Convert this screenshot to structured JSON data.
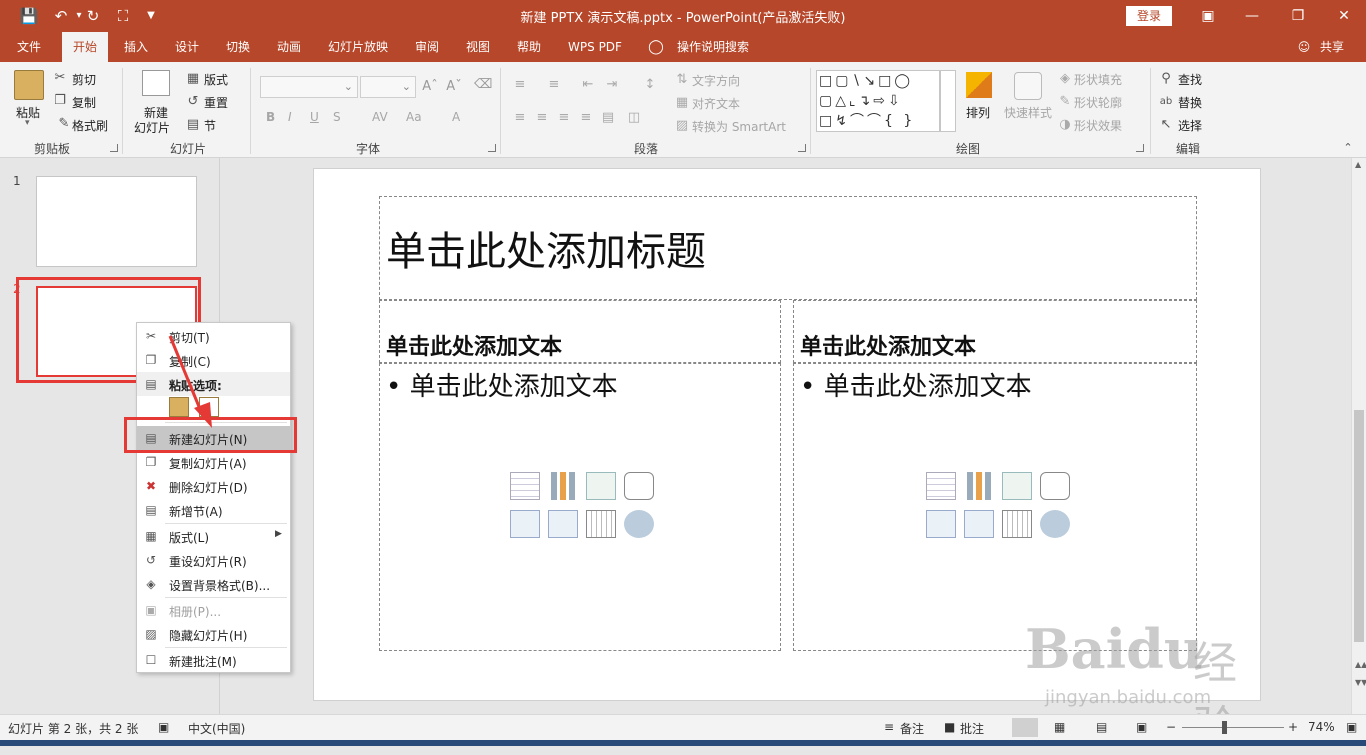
{
  "window": {
    "title": "新建 PPTX 演示文稿.pptx  -  PowerPoint(产品激活失败)",
    "login_label": "登录"
  },
  "tabs": [
    {
      "label": "文件"
    },
    {
      "label": "开始"
    },
    {
      "label": "插入"
    },
    {
      "label": "设计"
    },
    {
      "label": "切换"
    },
    {
      "label": "动画"
    },
    {
      "label": "幻灯片放映"
    },
    {
      "label": "审阅"
    },
    {
      "label": "视图"
    },
    {
      "label": "帮助"
    },
    {
      "label": "WPS PDF"
    },
    {
      "label": "操作说明搜索"
    }
  ],
  "share_label": "共享",
  "ribbon": {
    "clipboard": {
      "paste": "粘贴",
      "cut": "剪切",
      "copy": "复制",
      "format_painter": "格式刷",
      "group": "剪贴板"
    },
    "slides": {
      "new_slide_line1": "新建",
      "new_slide_line2": "幻灯片",
      "layout": "版式",
      "reset": "重置",
      "section": "节",
      "group": "幻灯片"
    },
    "font": {
      "bold": "B",
      "italic": "I",
      "underline": "U",
      "shadow": "S",
      "spacing": "AV",
      "case": "Aa",
      "color": "A",
      "group": "字体"
    },
    "paragraph": {
      "text_direction": "文字方向",
      "align_text": "对齐文本",
      "smartart": "转换为 SmartArt",
      "group": "段落"
    },
    "drawing": {
      "arrange": "排列",
      "quick_styles": "快速样式",
      "shape_fill": "形状填充",
      "shape_outline": "形状轮廓",
      "shape_effects": "形状效果",
      "group": "绘图"
    },
    "editing": {
      "find": "查找",
      "replace": "替换",
      "select": "选择",
      "group": "编辑"
    }
  },
  "thumbnails": [
    {
      "number": "1"
    },
    {
      "number": "2"
    }
  ],
  "slide": {
    "title_placeholder": "单击此处添加标题",
    "left_heading": "单击此处添加文本",
    "left_body": "• 单击此处添加文本",
    "right_heading": "单击此处添加文本",
    "right_body": "• 单击此处添加文本"
  },
  "context_menu": {
    "cut": "剪切(T)",
    "copy": "复制(C)",
    "paste_options": "粘贴选项:",
    "new_slide": "新建幻灯片(N)",
    "duplicate_slide": "复制幻灯片(A)",
    "delete_slide": "删除幻灯片(D)",
    "new_section": "新增节(A)",
    "layout": "版式(L)",
    "reset_slide": "重设幻灯片(R)",
    "format_background": "设置背景格式(B)...",
    "photo_album": "相册(P)...",
    "hide_slide": "隐藏幻灯片(H)",
    "new_comment": "新建批注(M)"
  },
  "status": {
    "slide_info": "幻灯片 第 2 张，共 2 张",
    "language": "中文(中国)",
    "notes": "备注",
    "comments": "批注",
    "zoom": "74%",
    "zoom_level": 0.4
  },
  "watermark": {
    "brand": "Baidu",
    "brand_cn": "经验",
    "url": "jingyan.baidu.com"
  },
  "colors": {
    "accent": "#b7472a",
    "annotation_red": "#e53935"
  }
}
